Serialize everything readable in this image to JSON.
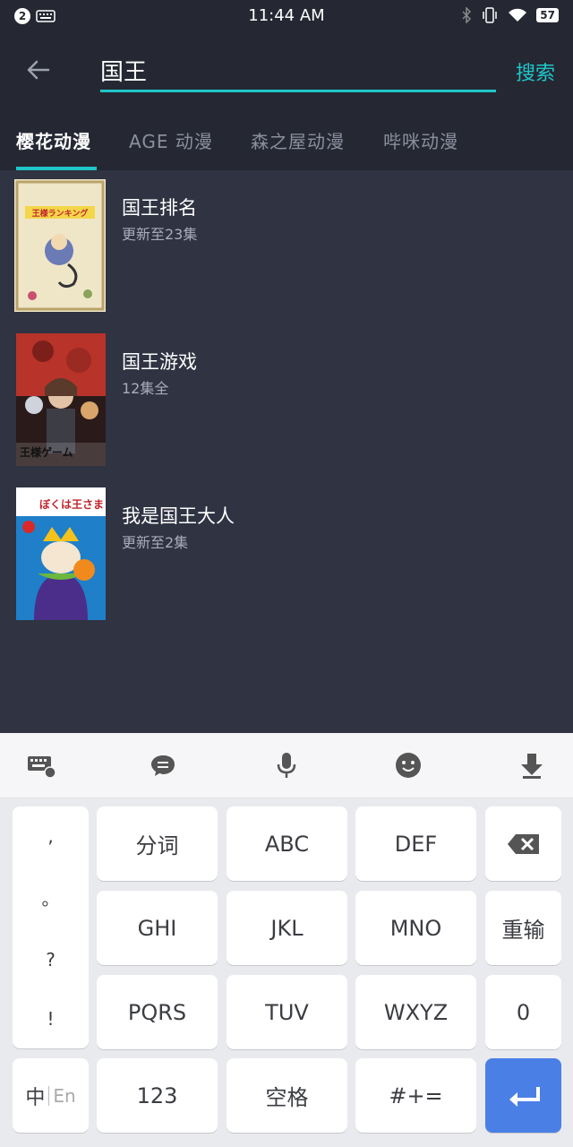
{
  "status_bar": {
    "time": "11:44 AM",
    "notif_count": "2",
    "battery": "57"
  },
  "header": {
    "search_value": "国王",
    "search_button": "搜索"
  },
  "tabs": [
    {
      "label": "樱花动漫"
    },
    {
      "label": "AGE 动漫"
    },
    {
      "label": "森之屋动漫"
    },
    {
      "label": "哔咪动漫"
    }
  ],
  "results": [
    {
      "title": "国王排名",
      "subtitle": "更新至23集",
      "cover_text": "王様ランキング"
    },
    {
      "title": "国王游戏",
      "subtitle": "12集全",
      "cover_text": "王様ゲーム"
    },
    {
      "title": "我是国王大人",
      "subtitle": "更新至2集",
      "cover_text": "ぼくは王さま"
    }
  ],
  "keyboard": {
    "punct": [
      ",",
      "。",
      "?",
      "!"
    ],
    "row1": [
      "分词",
      "ABC",
      "DEF"
    ],
    "row2": [
      "GHI",
      "JKL",
      "MNO",
      "重输"
    ],
    "row3": [
      "PQRS",
      "TUV",
      "WXYZ",
      "0"
    ],
    "row4": {
      "lang_zh": "中",
      "lang_en": "En",
      "num": "123",
      "space": "空格",
      "sym": "#+="
    }
  },
  "colors": {
    "accent": "#1fc6c9",
    "background": "#2f3342",
    "header": "#252833",
    "enter_key": "#4a7fe6"
  }
}
